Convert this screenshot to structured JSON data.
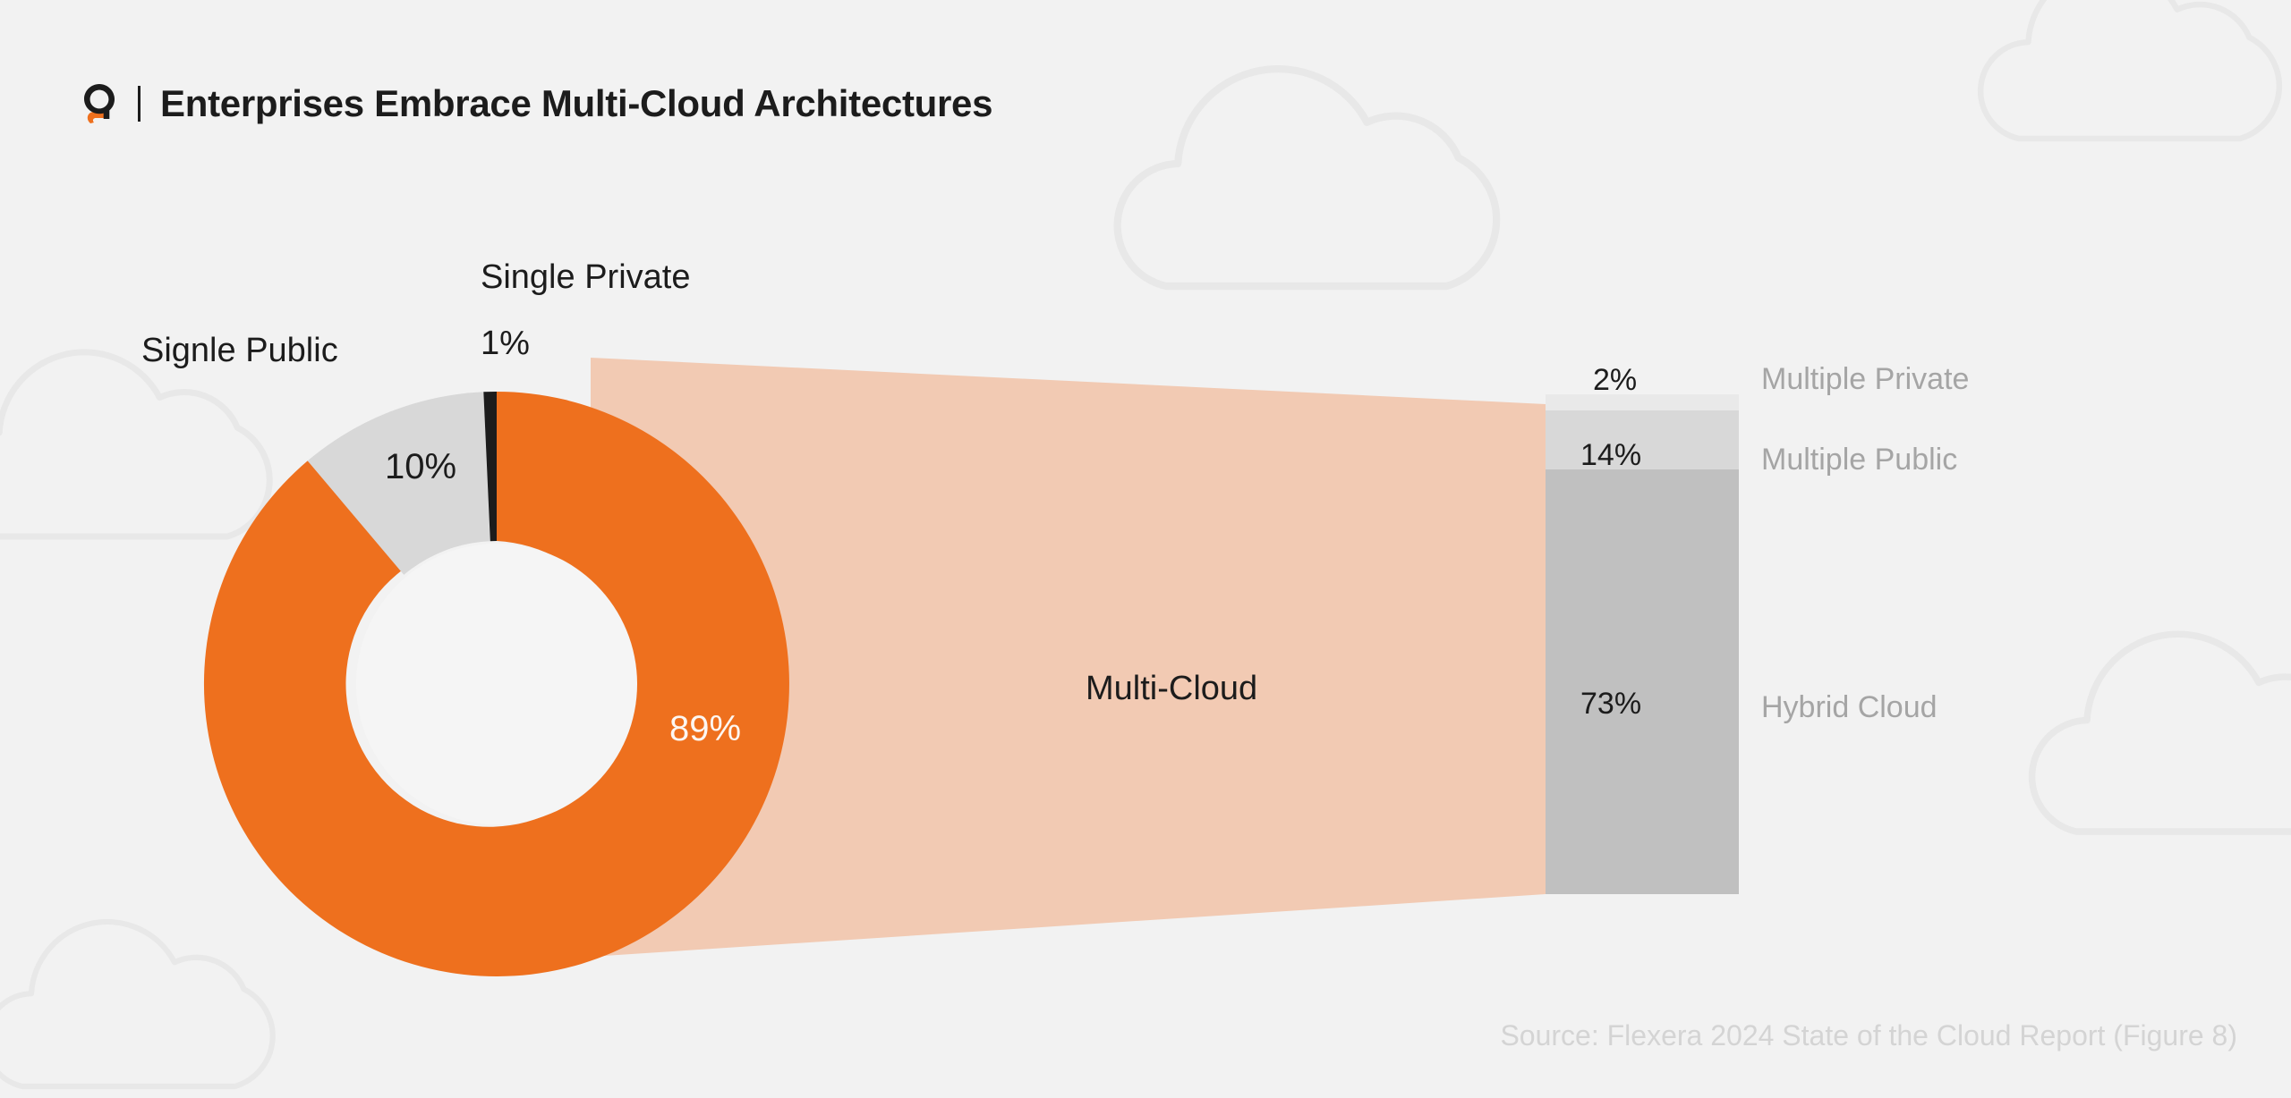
{
  "header": {
    "logo_icon": "flexera-q-logo-icon",
    "divider": "|",
    "title": "Enterprises Embrace Multi-Cloud Architectures"
  },
  "source": {
    "text": "Source: Flexera 2024 State of the Cloud Report (Figure 8)"
  },
  "colors": {
    "background": "#f2f2f2",
    "orange": "#ee701e",
    "peach": "#f2cab3",
    "light_gray": "#d8d8d8",
    "mid_gray": "#c0c0c0",
    "faint_gray": "#e9e9e9",
    "near_black": "#1c1c1c",
    "label_gray": "#a5a5a5",
    "source_gray": "#d4d4d4",
    "donut_hole": "#f5f5f5"
  },
  "donut": {
    "single_public_label": "Signle Public",
    "single_public_value": "10%",
    "single_private_label": "Single Private",
    "single_private_value": "1%",
    "multi_cloud_value": "89%"
  },
  "funnel": {
    "label": "Multi-Cloud"
  },
  "bar": {
    "multiple_private_value": "2%",
    "multiple_private_label": "Multiple Private",
    "multiple_public_value": "14%",
    "multiple_public_label": "Multiple Public",
    "hybrid_cloud_value": "73%",
    "hybrid_cloud_label": "Hybrid Cloud"
  },
  "chart_data": {
    "type": "pie",
    "title": "Enterprises Embrace Multi-Cloud Architectures",
    "subtitle": "",
    "xlabel": "",
    "ylabel": "",
    "source": "Source: Flexera 2024 State of the Cloud Report (Figure 8)",
    "legend_position": "inline-labels",
    "grid": false,
    "charts": [
      {
        "type": "pie",
        "name": "Cloud strategy (donut)",
        "hole": 0.49,
        "start_angle_deg": 0,
        "direction": "clockwise",
        "categories": [
          "Multi-Cloud",
          "Signle Public",
          "Single Private"
        ],
        "values": [
          89,
          10,
          1
        ],
        "unit": "%",
        "labels": [
          "89%",
          "10%",
          "1%"
        ],
        "colors": [
          "#ee701e",
          "#d8d8d8",
          "#1c1c1c"
        ]
      },
      {
        "type": "bar",
        "name": "Multi-Cloud breakdown (stacked bar)",
        "orientation": "vertical-stacked",
        "categories": [
          "Multiple Private",
          "Multiple Public",
          "Hybrid Cloud"
        ],
        "values": [
          2,
          14,
          73
        ],
        "unit": "%",
        "labels": [
          "2%",
          "14%",
          "73%"
        ],
        "colors": [
          "#e9e9e9",
          "#d8d8d8",
          "#c0c0c0"
        ],
        "total": 89,
        "ylim": [
          0,
          89
        ],
        "note": "Breakdown of the 89% Multi-Cloud slice; connected to donut by a peach funnel"
      }
    ]
  }
}
